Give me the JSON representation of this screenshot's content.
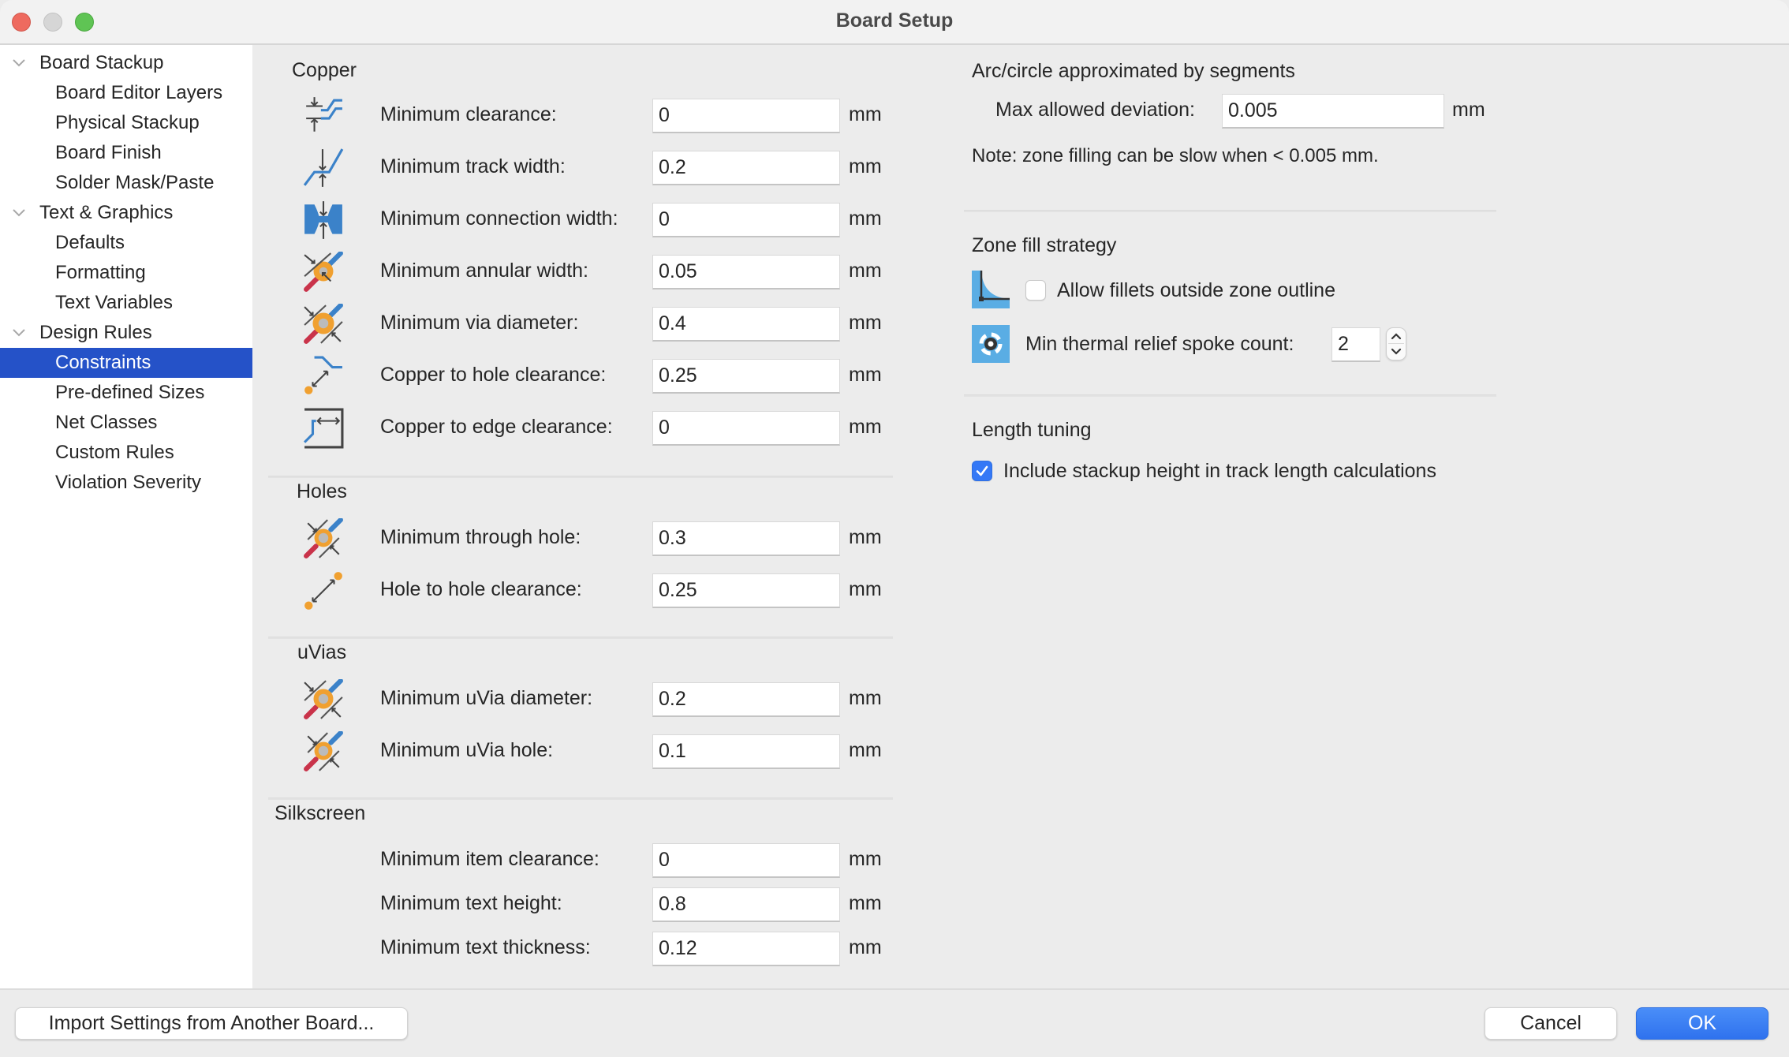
{
  "window": {
    "title": "Board Setup",
    "controls": [
      "close",
      "minimize",
      "maximize"
    ]
  },
  "sidebar": {
    "items": [
      {
        "label": "Board Stackup",
        "level": 0,
        "expanded": true
      },
      {
        "label": "Board Editor Layers",
        "level": 1
      },
      {
        "label": "Physical Stackup",
        "level": 1
      },
      {
        "label": "Board Finish",
        "level": 1
      },
      {
        "label": "Solder Mask/Paste",
        "level": 1
      },
      {
        "label": "Text & Graphics",
        "level": 0,
        "expanded": true
      },
      {
        "label": "Defaults",
        "level": 1
      },
      {
        "label": "Formatting",
        "level": 1
      },
      {
        "label": "Text Variables",
        "level": 1
      },
      {
        "label": "Design Rules",
        "level": 0,
        "expanded": true
      },
      {
        "label": "Constraints",
        "level": 1,
        "selected": true
      },
      {
        "label": "Pre-defined Sizes",
        "level": 1
      },
      {
        "label": "Net Classes",
        "level": 1
      },
      {
        "label": "Custom Rules",
        "level": 1
      },
      {
        "label": "Violation Severity",
        "level": 1
      }
    ],
    "selected_color": "#2552c8"
  },
  "constraints": {
    "copper": {
      "title": "Copper",
      "rows": [
        {
          "icon": "min-clearance-icon",
          "label": "Minimum clearance:",
          "value": "0",
          "unit": "mm"
        },
        {
          "icon": "min-track-width-icon",
          "label": "Minimum track width:",
          "value": "0.2",
          "unit": "mm"
        },
        {
          "icon": "min-connection-width-icon",
          "label": "Minimum connection width:",
          "value": "0",
          "unit": "mm"
        },
        {
          "icon": "min-annular-width-icon",
          "label": "Minimum annular width:",
          "value": "0.05",
          "unit": "mm"
        },
        {
          "icon": "min-via-diameter-icon",
          "label": "Minimum via diameter:",
          "value": "0.4",
          "unit": "mm"
        },
        {
          "icon": "copper-to-hole-icon",
          "label": "Copper to hole clearance:",
          "value": "0.25",
          "unit": "mm"
        },
        {
          "icon": "copper-to-edge-icon",
          "label": "Copper to edge clearance:",
          "value": "0",
          "unit": "mm"
        }
      ]
    },
    "holes": {
      "title": "Holes",
      "rows": [
        {
          "icon": "min-through-hole-icon",
          "label": "Minimum through hole:",
          "value": "0.3",
          "unit": "mm"
        },
        {
          "icon": "hole-to-hole-icon",
          "label": "Hole to hole clearance:",
          "value": "0.25",
          "unit": "mm"
        }
      ]
    },
    "uvias": {
      "title": "uVias",
      "rows": [
        {
          "icon": "min-uvia-diameter-icon",
          "label": "Minimum uVia diameter:",
          "value": "0.2",
          "unit": "mm"
        },
        {
          "icon": "min-uvia-hole-icon",
          "label": "Minimum uVia hole:",
          "value": "0.1",
          "unit": "mm"
        }
      ]
    },
    "silkscreen": {
      "title": "Silkscreen",
      "rows": [
        {
          "label": "Minimum item clearance:",
          "value": "0",
          "unit": "mm"
        },
        {
          "label": "Minimum text height:",
          "value": "0.8",
          "unit": "mm"
        },
        {
          "label": "Minimum text thickness:",
          "value": "0.12",
          "unit": "mm"
        }
      ]
    }
  },
  "arc": {
    "title": "Arc/circle approximated by segments",
    "label": "Max allowed deviation:",
    "value": "0.005",
    "unit": "mm",
    "note": "Note: zone filling can be slow when < 0.005 mm."
  },
  "zone_fill": {
    "title": "Zone fill strategy",
    "fillets_label": "Allow fillets outside zone outline",
    "fillets_checked": false,
    "spoke_label": "Min thermal relief spoke count:",
    "spoke_value": "2"
  },
  "length_tuning": {
    "title": "Length tuning",
    "stackup_label": "Include stackup height in track length calculations",
    "stackup_checked": true
  },
  "footer": {
    "import_label": "Import Settings from Another Board...",
    "cancel_label": "Cancel",
    "ok_label": "OK",
    "accent": "#3478f6"
  }
}
